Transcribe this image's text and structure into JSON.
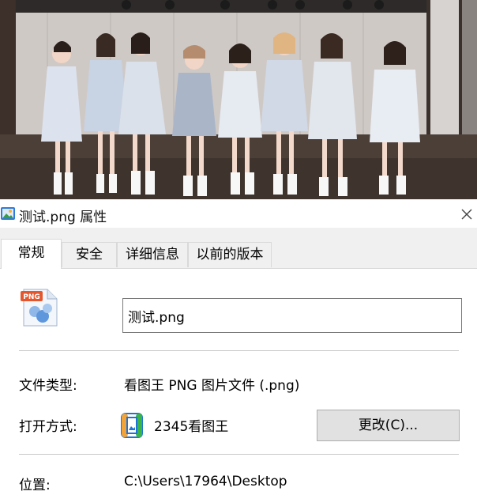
{
  "window": {
    "title": "测试.png 属性"
  },
  "tabs": [
    {
      "label": "常规",
      "active": true
    },
    {
      "label": "安全",
      "active": false
    },
    {
      "label": "详细信息",
      "active": false
    },
    {
      "label": "以前的版本",
      "active": false
    }
  ],
  "general": {
    "filename": "测试.png",
    "file_type_label": "文件类型:",
    "file_type_value": "看图王 PNG 图片文件 (.png)",
    "open_with_label": "打开方式:",
    "open_with_app": "2345看图王",
    "change_button": "更改(C)...",
    "location_label": "位置:",
    "location_value": "C:\\Users\\17964\\Desktop"
  },
  "icons": {
    "title_icon": "image-file-icon",
    "file_icon": "png-file-icon",
    "app_icon": "2345-viewer-icon",
    "close_icon": "close-icon",
    "file_icon_badge": "PNG"
  },
  "colors": {
    "window_bg": "#ffffff",
    "tab_bg": "#f0f0f0",
    "button_bg": "#e1e1e1",
    "accent_blue": "#1e74d6",
    "badge_orange": "#e4572e"
  }
}
